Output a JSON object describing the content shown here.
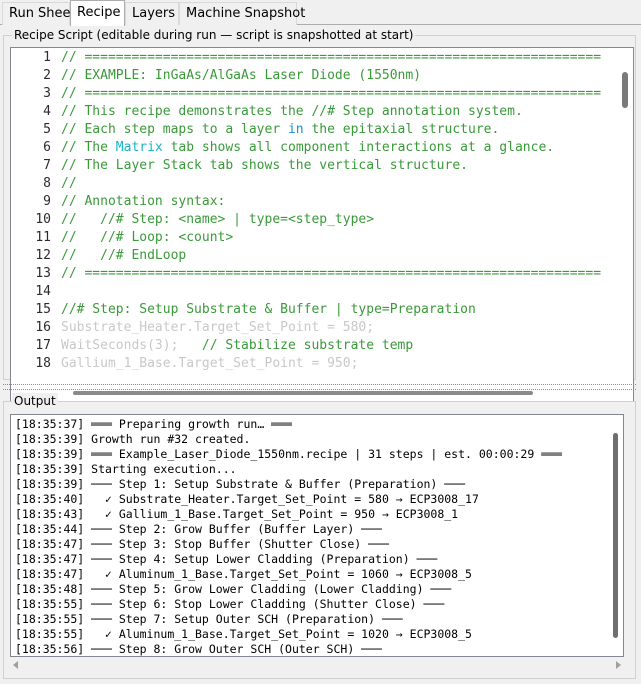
{
  "tabs": [
    {
      "label": "Run Sheet",
      "active": false
    },
    {
      "label": "Recipe",
      "active": true
    },
    {
      "label": "Layers",
      "active": false
    },
    {
      "label": "Machine Snapshot",
      "active": false
    }
  ],
  "recipe_group": {
    "title": "Recipe Script (editable during run — script is snapshotted at start)"
  },
  "editor": {
    "line_numbers": [
      "1",
      "2",
      "3",
      "4",
      "5",
      "6",
      "7",
      "8",
      "9",
      "10",
      "11",
      "12",
      "13",
      "14",
      "15",
      "16",
      "17",
      "18"
    ],
    "lines": [
      [
        {
          "t": "// ==================================================================",
          "c": "comment"
        }
      ],
      [
        {
          "t": "// EXAMPLE: InGaAs/AlGaAs Laser Diode (1550nm)",
          "c": "comment"
        }
      ],
      [
        {
          "t": "// ==================================================================",
          "c": "comment"
        }
      ],
      [
        {
          "t": "// This recipe demonstrates the //# Step annotation system.",
          "c": "comment"
        }
      ],
      [
        {
          "t": "// Each step maps to a layer ",
          "c": "comment"
        },
        {
          "t": "in",
          "c": "kw"
        },
        {
          "t": " the epitaxial structure.",
          "c": "comment"
        }
      ],
      [
        {
          "t": "// The ",
          "c": "comment"
        },
        {
          "t": "Matrix",
          "c": "mt"
        },
        {
          "t": " tab shows all component interactions at a glance.",
          "c": "comment"
        }
      ],
      [
        {
          "t": "// The Layer Stack tab shows the vertical structure.",
          "c": "comment"
        }
      ],
      [
        {
          "t": "//",
          "c": "comment"
        }
      ],
      [
        {
          "t": "// Annotation syntax:",
          "c": "comment"
        }
      ],
      [
        {
          "t": "//   //# Step: <name> | type=<step_type>",
          "c": "comment"
        }
      ],
      [
        {
          "t": "//   //# Loop: <count>",
          "c": "comment"
        }
      ],
      [
        {
          "t": "//   //# EndLoop",
          "c": "comment"
        }
      ],
      [
        {
          "t": "// ==================================================================",
          "c": "comment"
        }
      ],
      [
        {
          "t": "",
          "c": "comment"
        }
      ],
      [
        {
          "t": "//# Step: Setup Substrate & Buffer | type=Preparation",
          "c": "comment"
        }
      ],
      [
        {
          "t": "Substrate_Heater.Target_Set_Point = 580;",
          "c": "faded"
        }
      ],
      [
        {
          "t": "WaitSeconds(3);",
          "c": "faded"
        },
        {
          "t": "   // Stabilize substrate temp",
          "c": "comment"
        }
      ],
      [
        {
          "t": "Gallium_1_Base.Target_Set_Point = 950;",
          "c": "faded"
        }
      ]
    ]
  },
  "output_group": {
    "title": "Output"
  },
  "output": {
    "lines": [
      "[18:35:37] ═══ Preparing growth run… ═══",
      "[18:35:39] Growth run #32 created.",
      "[18:35:39] ═══ Example_Laser_Diode_1550nm.recipe | 31 steps | est. 00:00:29 ═══",
      "[18:35:39] Starting execution...",
      "[18:35:39] ─── Step 1: Setup Substrate & Buffer (Preparation) ───",
      "[18:35:40]   ✓ Substrate_Heater.Target_Set_Point = 580 → ECP3008_17",
      "[18:35:43]   ✓ Gallium_1_Base.Target_Set_Point = 950 → ECP3008_1",
      "[18:35:44] ─── Step 2: Grow Buffer (Buffer Layer) ───",
      "[18:35:47] ─── Step 3: Stop Buffer (Shutter Close) ───",
      "[18:35:47] ─── Step 4: Setup Lower Cladding (Preparation) ───",
      "[18:35:47]   ✓ Aluminum_1_Base.Target_Set_Point = 1060 → ECP3008_5",
      "[18:35:48] ─── Step 5: Grow Lower Cladding (Lower Cladding) ───",
      "[18:35:55] ─── Step 6: Stop Lower Cladding (Shutter Close) ───",
      "[18:35:55] ─── Step 7: Setup Outer SCH (Preparation) ───",
      "[18:35:55]   ✓ Aluminum_1_Base.Target_Set_Point = 1020 → ECP3008_5",
      "[18:35:56] ─── Step 8: Grow Outer SCH (Outer SCH) ───"
    ]
  }
}
